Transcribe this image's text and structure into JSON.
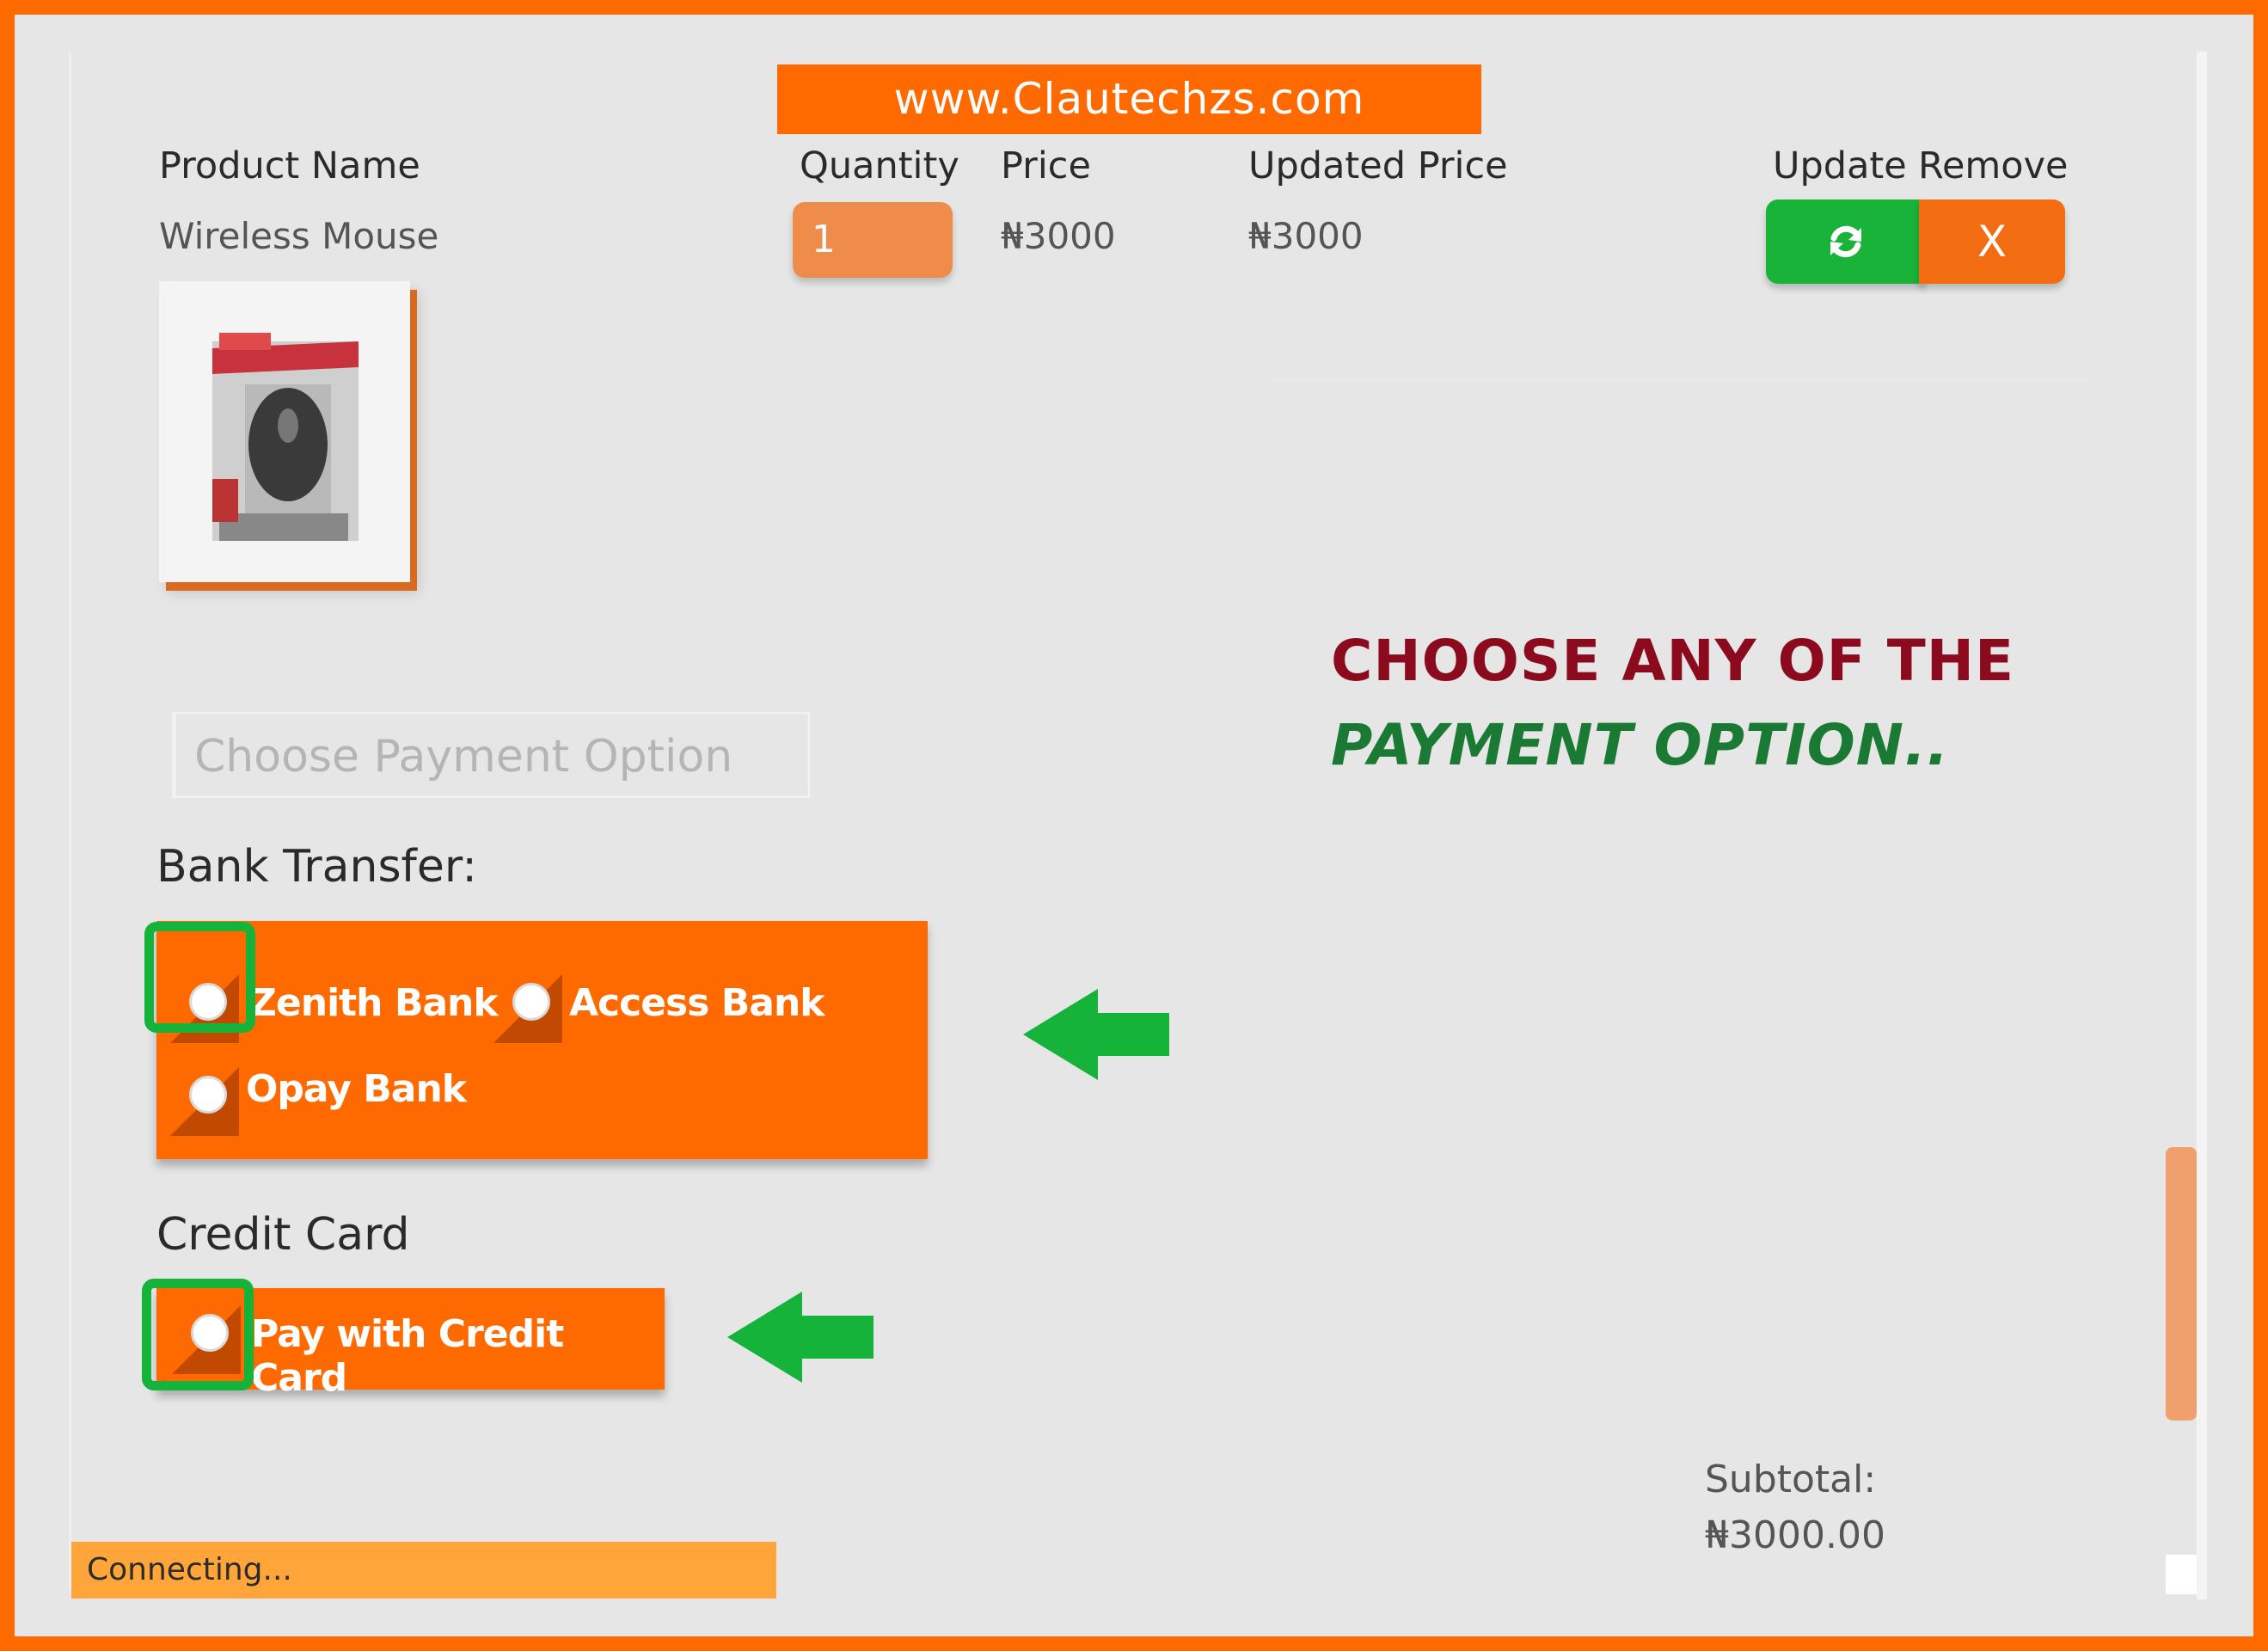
{
  "site": {
    "banner": "www.Clautechzs.com"
  },
  "cart": {
    "headers": {
      "product_name": "Product Name",
      "quantity": "Quantity",
      "price": "Price",
      "updated_price": "Updated Price",
      "update": "Update",
      "remove": "Remove"
    },
    "item": {
      "name": "Wireless Mouse",
      "quantity": "1",
      "price": "₦3000",
      "updated_price": "₦3000",
      "update_icon": "refresh-icon",
      "remove_label": "X"
    }
  },
  "payment": {
    "select_placeholder": "Choose Payment Option",
    "bank_transfer_label": "Bank Transfer:",
    "bank_options": [
      "Zenith Bank",
      "Access Bank",
      "Opay Bank"
    ],
    "credit_card_label": "Credit Card",
    "credit_card_option": "Pay with Credit Card"
  },
  "annotation": {
    "line1": "CHOOSE ANY OF THE",
    "line2": "PAYMENT OPTION..",
    "colors": {
      "line1": "#8b0a1e",
      "line2": "#1a7a34",
      "highlight": "#16b33a",
      "accent": "#ff6a00"
    }
  },
  "summary": {
    "subtotal_label": "Subtotal:",
    "subtotal_value": "₦3000.00"
  },
  "status": {
    "text": "Connecting..."
  }
}
